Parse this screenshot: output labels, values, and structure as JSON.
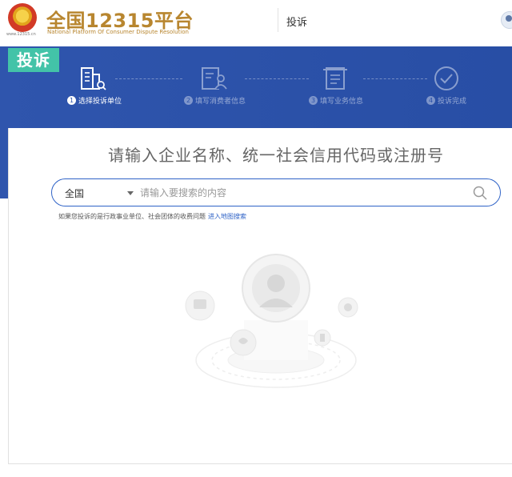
{
  "header": {
    "emblem_url": "www.12315.cn",
    "title": "全国12315平台",
    "subtitle": "National Platform Of Consumer Dispute Resolution",
    "nav_link": "投诉"
  },
  "banner": {
    "tag": "投诉"
  },
  "steps": [
    {
      "num": "1",
      "label": "选择投诉单位",
      "active": true,
      "icon": "building-search-icon"
    },
    {
      "num": "2",
      "label": "填写消费者信息",
      "active": false,
      "icon": "user-form-icon"
    },
    {
      "num": "3",
      "label": "填写业务信息",
      "active": false,
      "icon": "document-icon"
    },
    {
      "num": "4",
      "label": "投诉完成",
      "active": false,
      "icon": "check-circle-icon"
    }
  ],
  "main": {
    "headline": "请输入企业名称、统一社会信用代码或注册号",
    "search": {
      "region": "全国",
      "placeholder": "请输入要搜索的内容",
      "value": ""
    },
    "hint": {
      "text": "如果您投诉的是行政事业单位、社会团体的收费问题",
      "link": "进入地图搜索"
    }
  },
  "colors": {
    "brand_gold": "#b8862f",
    "band_blue": "#2c52a9",
    "tag_teal": "#43c3a8",
    "link_blue": "#2f63c7"
  }
}
